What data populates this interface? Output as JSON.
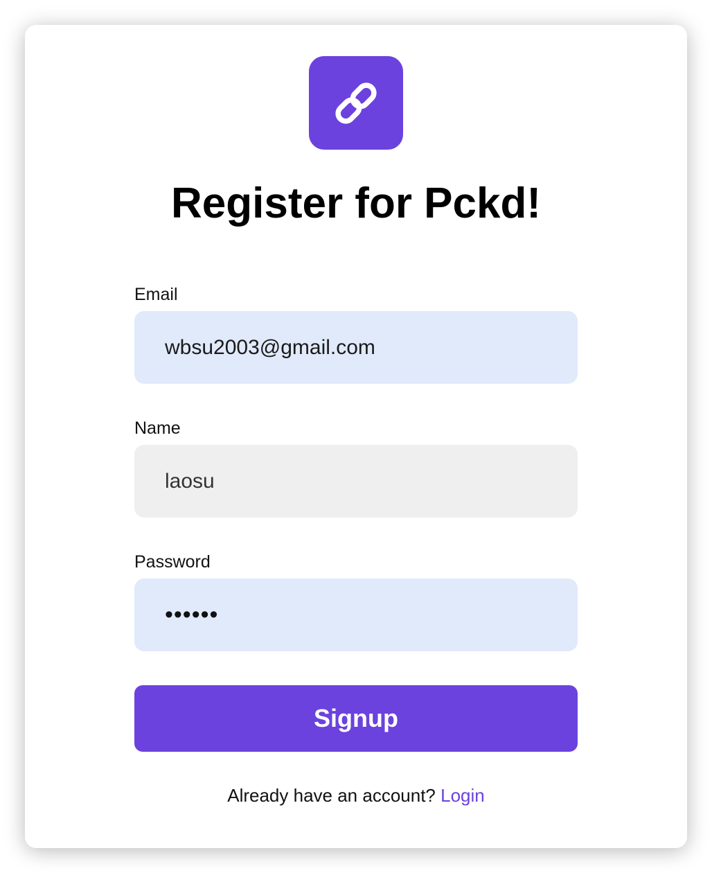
{
  "brand": {
    "logo_icon": "link-icon",
    "accent_color": "#6b42dd"
  },
  "title": "Register for Pckd!",
  "form": {
    "email": {
      "label": "Email",
      "value": "wbsu2003@gmail.com"
    },
    "name": {
      "label": "Name",
      "value": "laosu"
    },
    "password": {
      "label": "Password",
      "value": "••••••"
    },
    "submit_label": "Signup"
  },
  "footer": {
    "prompt": "Already have an account?",
    "link_label": "Login"
  }
}
